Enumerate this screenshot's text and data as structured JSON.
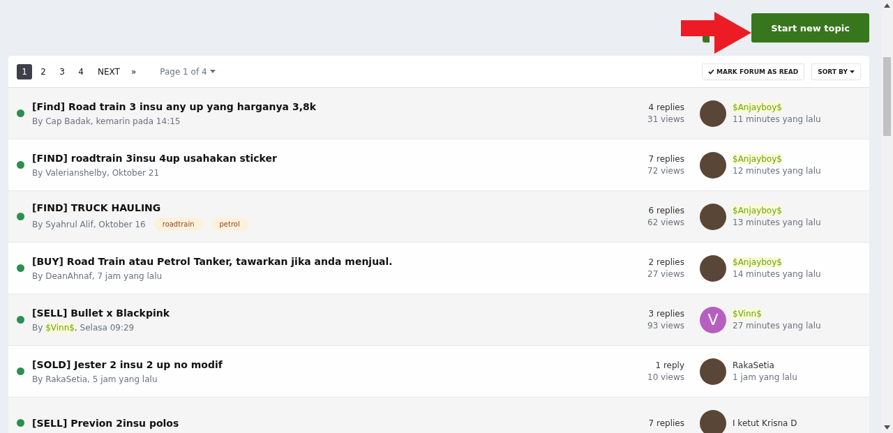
{
  "actions": {
    "start_button": "Start new topic"
  },
  "pagination": {
    "pages": [
      {
        "label": "1",
        "selected": true
      },
      {
        "label": "2",
        "selected": false
      },
      {
        "label": "3",
        "selected": false
      },
      {
        "label": "4",
        "selected": false
      }
    ],
    "next": "NEXT",
    "last": "»",
    "page_jump": "Page 1 of 4"
  },
  "toolbar": {
    "mark_read": "MARK FORUM AS READ",
    "sort": "SORT BY"
  },
  "topics": [
    {
      "title": "[Find] Road train 3 insu any up yang harganya 3,8k",
      "by": "By",
      "author": {
        "name": "Cap Badak"
      },
      "date": ", kemarin pada 14:15",
      "unread": true,
      "replies": "4 replies",
      "views": "31 views",
      "last_poster": {
        "name": "$Anjayboy$",
        "color": "#6aa51d",
        "time": "11 minutes yang lalu"
      }
    },
    {
      "title": "[FIND] roadtrain 3insu 4up usahakan sticker",
      "by": "By",
      "author": {
        "name": "Valerianshelby"
      },
      "date": ", Oktober 21",
      "unread": true,
      "replies": "7 replies",
      "views": "72 views",
      "last_poster": {
        "name": "$Anjayboy$",
        "color": "#6aa51d",
        "time": "12 minutes yang lalu"
      }
    },
    {
      "title": "[FIND] TRUCK HAULING",
      "by": "By",
      "author": {
        "name": "Syahrul Alif"
      },
      "date": ", Oktober 16",
      "tags": [
        "roadtrain",
        "petrol"
      ],
      "unread": true,
      "replies": "6 replies",
      "views": "62 views",
      "last_poster": {
        "name": "$Anjayboy$",
        "color": "#6aa51d",
        "time": "13 minutes yang lalu"
      }
    },
    {
      "title": "[BUY] Road Train atau Petrol Tanker, tawarkan jika anda menjual.",
      "by": "By",
      "author": {
        "name": "DeanAhnaf"
      },
      "date": ", 7 jam yang lalu",
      "unread": true,
      "replies": "2 replies",
      "views": "27 views",
      "last_poster": {
        "name": "$Anjayboy$",
        "color": "#6aa51d",
        "time": "14 minutes yang lalu"
      }
    },
    {
      "title": "[SELL] Bullet x Blackpink",
      "by": "By",
      "author": {
        "name": "$Vinn$",
        "color": "#6aa51d"
      },
      "date": ", Selasa 09:29",
      "unread": true,
      "replies": "3 replies",
      "views": "93 views",
      "last_poster": {
        "name": "$Vinn$",
        "color": "#6aa51d",
        "avatar": {
          "letter": "V",
          "color": "#b65fc0"
        },
        "time": "27 minutes yang lalu"
      }
    },
    {
      "title": "[SOLD] Jester 2 insu 2 up no modif",
      "by": "By",
      "author": {
        "name": "RakaSetia"
      },
      "date": ", 5 jam yang lalu",
      "unread": true,
      "replies": "1 reply",
      "views": "10 views",
      "last_poster": {
        "name": "RakaSetia",
        "time": "1 jam yang lalu"
      }
    },
    {
      "title": "[SELL] Previon 2insu polos",
      "unread": true,
      "replies": "7 replies",
      "last_poster": {
        "name": "I ketut Krisna D"
      }
    }
  ]
}
